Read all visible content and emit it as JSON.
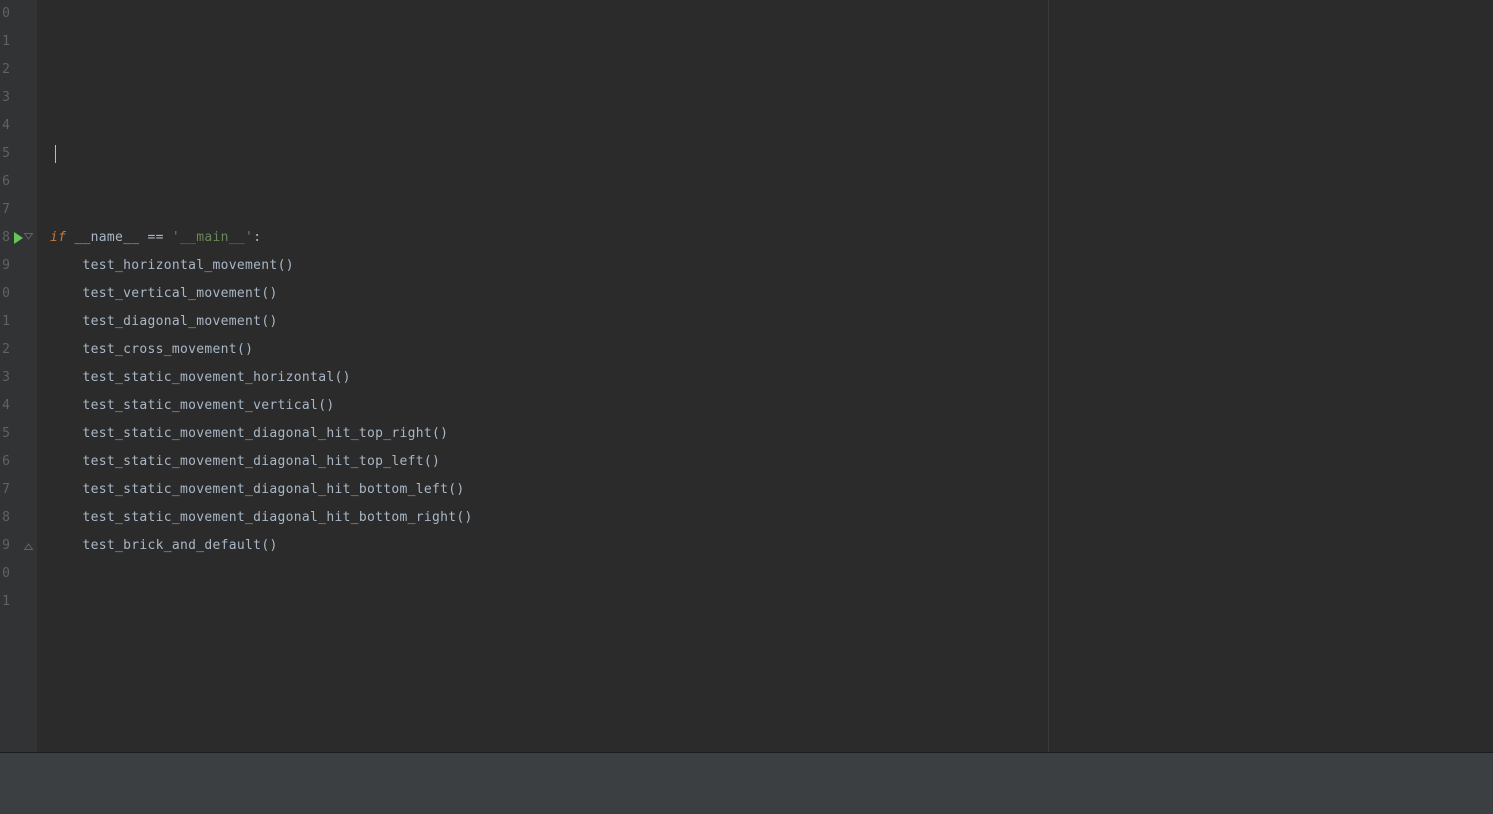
{
  "editor": {
    "line_numbers": [
      "0",
      "1",
      "2",
      "3",
      "4",
      "5",
      "6",
      "7",
      "8",
      "9",
      "0",
      "1",
      "2",
      "3",
      "4",
      "5",
      "6",
      "7",
      "8",
      "9",
      "0",
      "1"
    ],
    "run_line_index": 8,
    "current_line_index": 5,
    "fold_start_index": 8,
    "fold_end_index": 19,
    "lines": [
      {
        "tokens": []
      },
      {
        "tokens": []
      },
      {
        "tokens": []
      },
      {
        "tokens": []
      },
      {
        "tokens": []
      },
      {
        "tokens": []
      },
      {
        "tokens": []
      },
      {
        "tokens": []
      },
      {
        "tokens": [
          {
            "t": "if ",
            "c": "kw"
          },
          {
            "t": "__name__",
            "c": "ident"
          },
          {
            "t": " == ",
            "c": "op"
          },
          {
            "t": "'__main__'",
            "c": "str"
          },
          {
            "t": ":",
            "c": "op"
          }
        ]
      },
      {
        "tokens": [
          {
            "t": "    ",
            "c": "op"
          },
          {
            "t": "test_horizontal_movement",
            "c": "func"
          },
          {
            "t": "()",
            "c": "paren"
          }
        ]
      },
      {
        "tokens": [
          {
            "t": "    ",
            "c": "op"
          },
          {
            "t": "test_vertical_movement",
            "c": "func"
          },
          {
            "t": "()",
            "c": "paren"
          }
        ]
      },
      {
        "tokens": [
          {
            "t": "    ",
            "c": "op"
          },
          {
            "t": "test_diagonal_movement",
            "c": "func"
          },
          {
            "t": "()",
            "c": "paren"
          }
        ]
      },
      {
        "tokens": [
          {
            "t": "    ",
            "c": "op"
          },
          {
            "t": "test_cross_movement",
            "c": "func"
          },
          {
            "t": "()",
            "c": "paren"
          }
        ]
      },
      {
        "tokens": [
          {
            "t": "    ",
            "c": "op"
          },
          {
            "t": "test_static_movement_horizontal",
            "c": "func"
          },
          {
            "t": "()",
            "c": "paren"
          }
        ]
      },
      {
        "tokens": [
          {
            "t": "    ",
            "c": "op"
          },
          {
            "t": "test_static_movement_vertical",
            "c": "func"
          },
          {
            "t": "()",
            "c": "paren"
          }
        ]
      },
      {
        "tokens": [
          {
            "t": "    ",
            "c": "op"
          },
          {
            "t": "test_static_movement_diagonal_hit_top_right",
            "c": "func"
          },
          {
            "t": "()",
            "c": "paren"
          }
        ]
      },
      {
        "tokens": [
          {
            "t": "    ",
            "c": "op"
          },
          {
            "t": "test_static_movement_diagonal_hit_top_left",
            "c": "func"
          },
          {
            "t": "()",
            "c": "paren"
          }
        ]
      },
      {
        "tokens": [
          {
            "t": "    ",
            "c": "op"
          },
          {
            "t": "test_static_movement_diagonal_hit_bottom_left",
            "c": "func"
          },
          {
            "t": "()",
            "c": "paren"
          }
        ]
      },
      {
        "tokens": [
          {
            "t": "    ",
            "c": "op"
          },
          {
            "t": "test_static_movement_diagonal_hit_bottom_right",
            "c": "func"
          },
          {
            "t": "()",
            "c": "paren"
          }
        ]
      },
      {
        "tokens": [
          {
            "t": "    ",
            "c": "op"
          },
          {
            "t": "test_brick_and_default",
            "c": "func"
          },
          {
            "t": "()",
            "c": "paren"
          }
        ]
      },
      {
        "tokens": []
      },
      {
        "tokens": []
      }
    ]
  }
}
